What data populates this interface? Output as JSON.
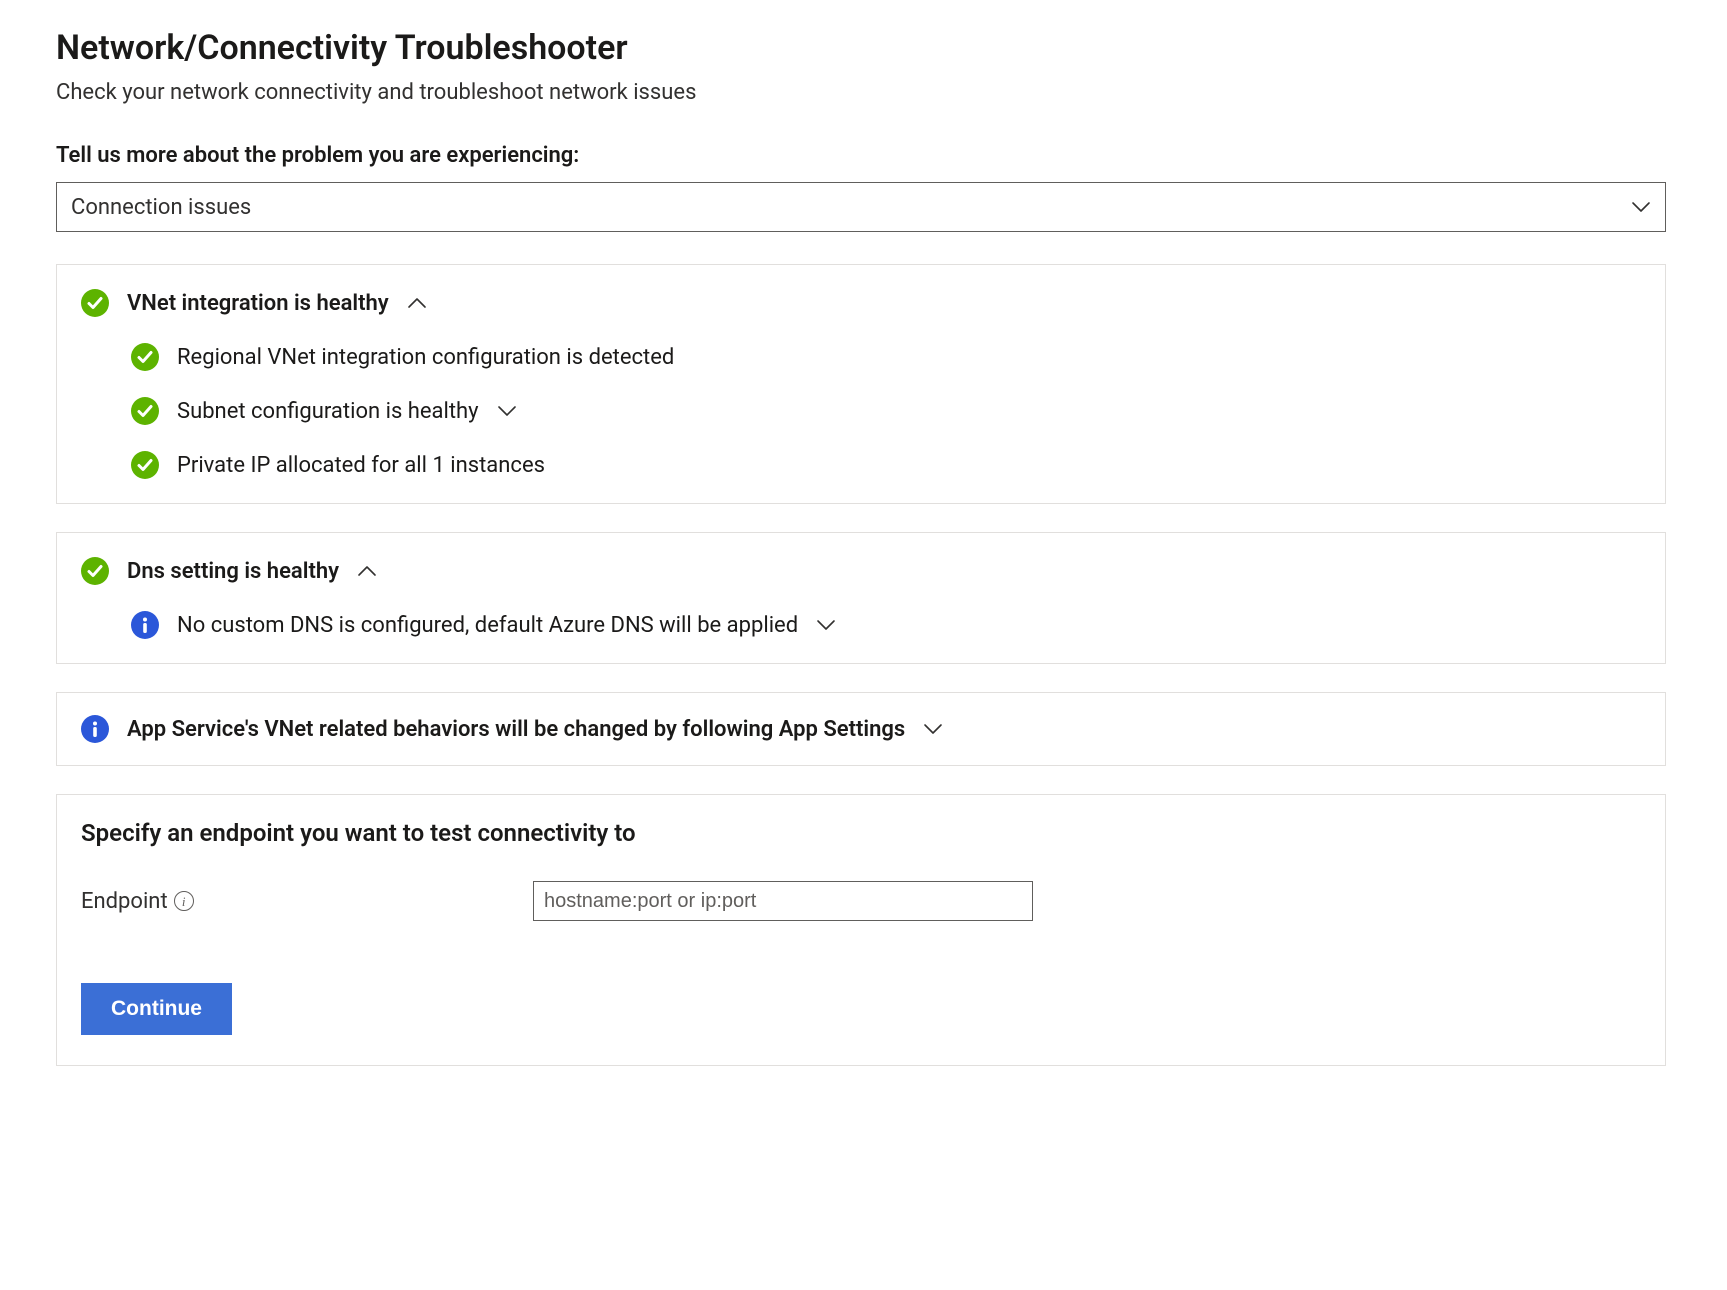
{
  "header": {
    "title": "Network/Connectivity Troubleshooter",
    "subtitle": "Check your network connectivity and troubleshoot network issues"
  },
  "prompt": {
    "label": "Tell us more about the problem you are experiencing:",
    "selected": "Connection issues"
  },
  "panels": {
    "vnet": {
      "header": "VNet integration is healthy",
      "items": [
        "Regional VNet integration configuration is detected",
        "Subnet configuration is healthy",
        "Private IP allocated for all 1 instances"
      ]
    },
    "dns": {
      "header": "Dns setting is healthy",
      "items": [
        "No custom DNS is configured, default Azure DNS will be applied"
      ]
    },
    "appsettings": {
      "header": "App Service's VNet related behaviors will be changed by following App Settings"
    }
  },
  "endpoint": {
    "title": "Specify an endpoint you want to test connectivity to",
    "label": "Endpoint",
    "placeholder": "hostname:port or ip:port",
    "value": ""
  },
  "actions": {
    "continue": "Continue"
  },
  "colors": {
    "success": "#5db300",
    "info": "#2b57d9",
    "primary": "#3b6fd6"
  }
}
